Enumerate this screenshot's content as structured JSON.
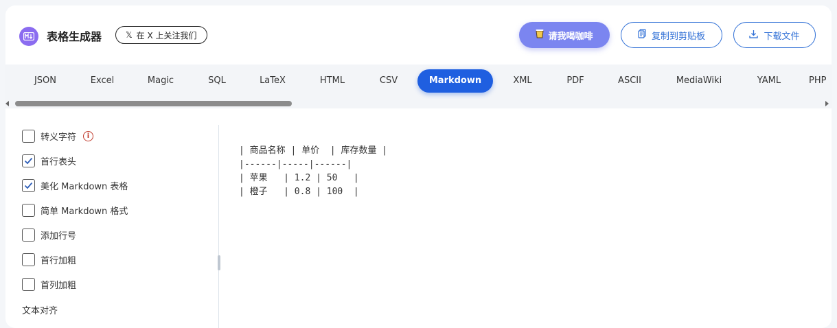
{
  "header": {
    "app_title": "表格生成器",
    "follow_label": "在 X 上关注我们",
    "coffee_label": "请我喝咖啡",
    "copy_label": "复制到剪贴板",
    "download_label": "下载文件",
    "accent": "#1f5fe0",
    "logo_color": "#8b6cf0"
  },
  "tabs": [
    {
      "label": "JSON"
    },
    {
      "label": "Excel"
    },
    {
      "label": "Magic"
    },
    {
      "label": "SQL"
    },
    {
      "label": "LaTeX"
    },
    {
      "label": "HTML"
    },
    {
      "label": "CSV"
    },
    {
      "label": "Markdown",
      "active": true
    },
    {
      "label": "XML"
    },
    {
      "label": "PDF"
    },
    {
      "label": "ASCII"
    },
    {
      "label": "MediaWiki"
    },
    {
      "label": "YAML"
    },
    {
      "label": "PHP"
    }
  ],
  "options": [
    {
      "label": "转义字符",
      "checked": false,
      "info": true
    },
    {
      "label": "首行表头",
      "checked": true
    },
    {
      "label": "美化 Markdown 表格",
      "checked": true
    },
    {
      "label": "简单 Markdown 格式",
      "checked": false
    },
    {
      "label": "添加行号",
      "checked": false
    },
    {
      "label": "首行加粗",
      "checked": false
    },
    {
      "label": "首列加粗",
      "checked": false
    }
  ],
  "align_label": "文本对齐",
  "output_lines": [
    "| 商品名称 | 单价  | 库存数量 |",
    "|------|-----|------|",
    "| 苹果   | 1.2 | 50   |",
    "| 橙子   | 0.8 | 100  |"
  ]
}
